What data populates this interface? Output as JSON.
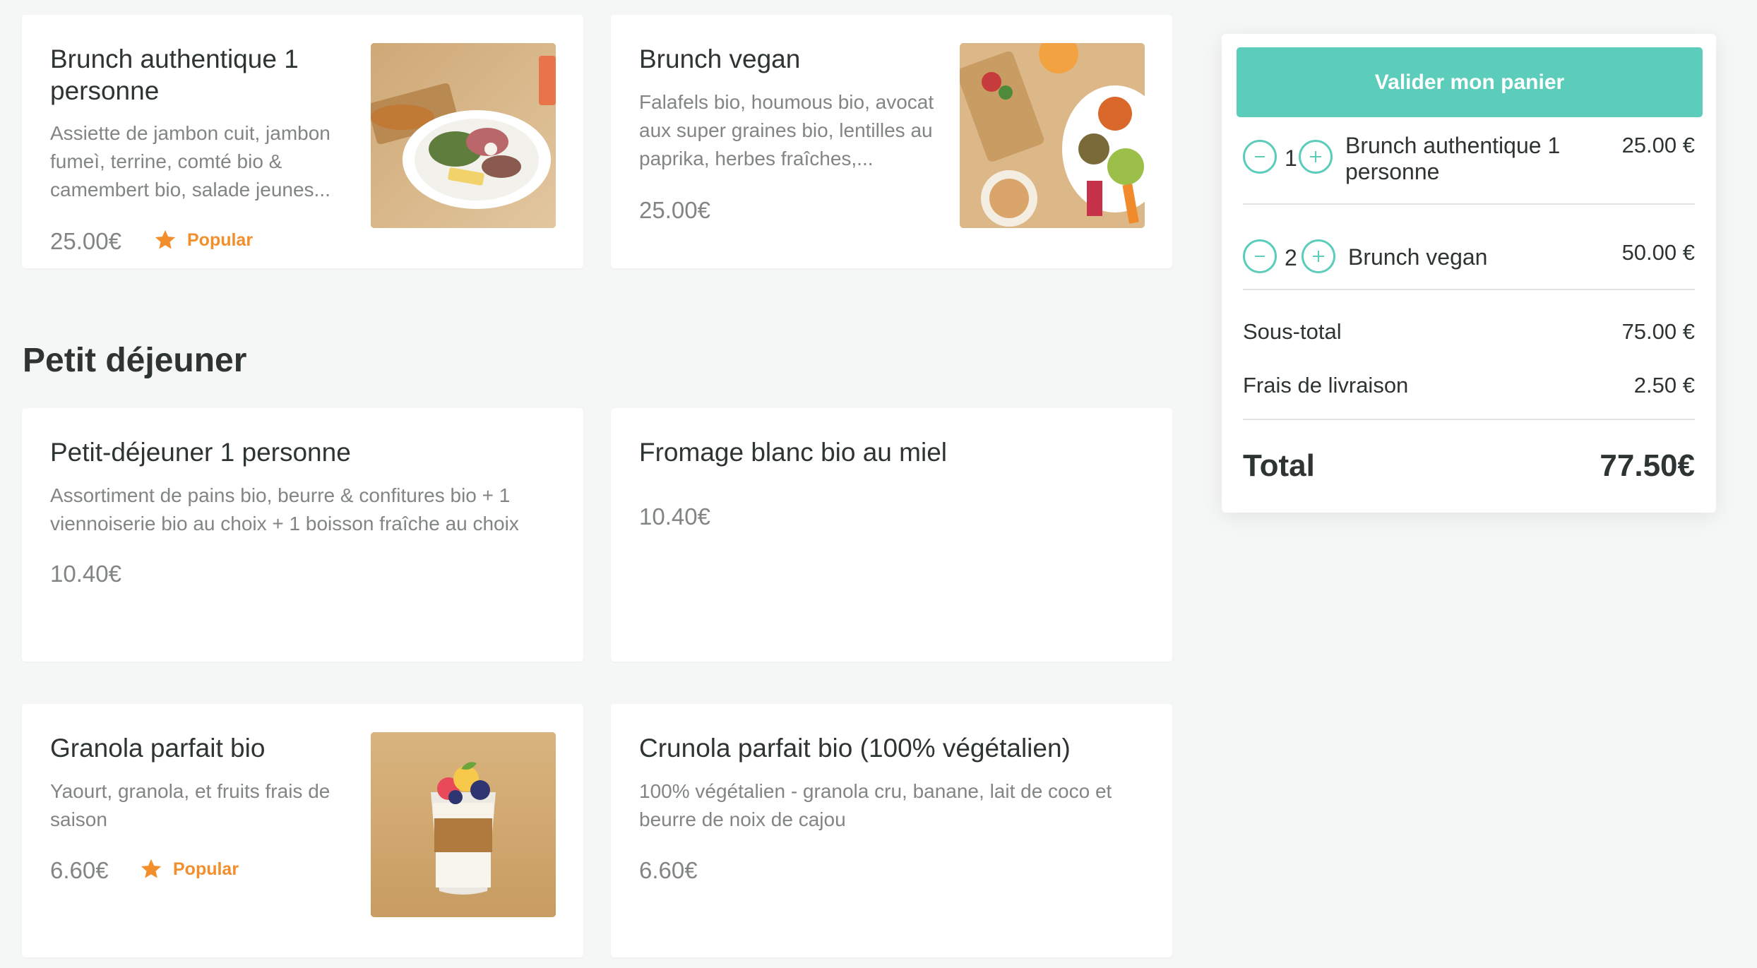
{
  "colors": {
    "accent": "#5ccdbb",
    "popular": "#f28f2c",
    "muted_text": "#828585",
    "background": "#f5f6f6"
  },
  "menu": {
    "brunch_items": [
      {
        "name": "Brunch authentique 1 personne",
        "description": "Assiette de jambon cuit, jambon fumeì, terrine, comté bio & camembert bio, salade jeunes...",
        "price": "25.00€",
        "popular_label": "Popular"
      },
      {
        "name": "Brunch vegan",
        "description": "Falafels bio, houmous bio, avocat aux super graines bio, lentilles au paprika, herbes fraîches,...",
        "price": "25.00€"
      }
    ],
    "section_title": "Petit déjeuner",
    "breakfast_items": [
      {
        "name": "Petit-déjeuner 1 personne",
        "description": "Assortiment de pains bio, beurre & confitures bio + 1 viennoiserie bio au choix + 1 boisson fraîche au choix",
        "price": "10.40€"
      },
      {
        "name": "Fromage blanc bio au miel",
        "price": "10.40€"
      },
      {
        "name": "Granola parfait bio",
        "description": "Yaourt, granola, et fruits frais de saison",
        "price": "6.60€",
        "popular_label": "Popular"
      },
      {
        "name": "Crunola parfait bio (100% végétalien)",
        "description": "100% végétalien - granola cru, banane, lait de coco et beurre de noix de cajou",
        "price": "6.60€"
      }
    ]
  },
  "cart": {
    "checkout_label": "Valider mon panier",
    "items": [
      {
        "qty": "1",
        "name": "Brunch authentique 1 personne",
        "price": "25.00 €"
      },
      {
        "qty": "2",
        "name": "Brunch vegan",
        "price": "50.00 €"
      }
    ],
    "subtotal_label": "Sous-total",
    "subtotal_value": "75.00 €",
    "delivery_label": "Frais de livraison",
    "delivery_value": "2.50 €",
    "total_label": "Total",
    "total_value": "77.50€"
  }
}
